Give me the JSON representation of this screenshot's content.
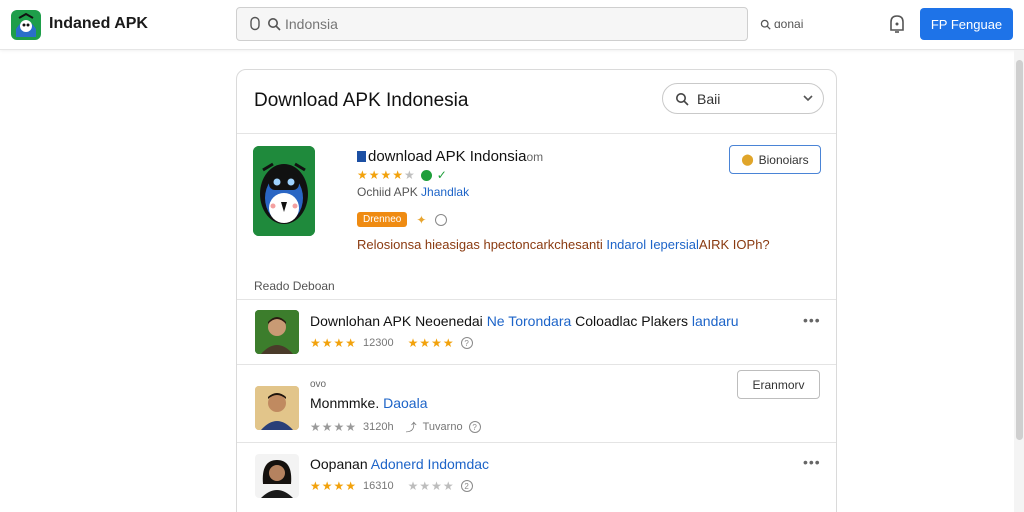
{
  "header": {
    "brand": "Indaned APK",
    "search_placeholder": "Indonsia",
    "search_link": "ɑonai",
    "cta_label": "FP Fenguae"
  },
  "card": {
    "title": "Download APK Indonesia",
    "filter_label": "Baii",
    "featured": {
      "title": "download APK Indonsia",
      "title_suffix": "om",
      "subtitle_prefix": "Ochiid APK",
      "subtitle_link": "Jhandlak",
      "badge": "Drenneo",
      "description_prefix": "Relosionsa hieasigas hpectoncarkchesanti",
      "description_blue": "Indarol Iepersial",
      "description_suffix": "AIRK IOPh?",
      "action_label": "Bionoiars",
      "rating": 4
    },
    "section_label": "Reado Deboan",
    "items": [
      {
        "title": "Downlohan APK Neoenedai",
        "title_blue": "Ne Torondara",
        "title_rest": "Coloadlac Plakers",
        "title_blue2": "landaru",
        "count": "12300",
        "rating_a": 4,
        "rating_b": 4,
        "has_menu": true
      },
      {
        "caption": "ovo",
        "title": "Monmmke.",
        "title_blue": "Daoala",
        "count": "3120h",
        "tag": "Tuvarno",
        "rating_a": 4,
        "action_label": "Eranmorv"
      },
      {
        "title": "Oopanan",
        "title_blue": "Adonerd Indomdac",
        "count": "16310",
        "rating_a": 4,
        "rating_b": 3,
        "has_menu": true
      }
    ]
  },
  "colors": {
    "primary": "#1e73e8",
    "star": "#f2a20c",
    "link": "#1d64c8",
    "badge": "#ef8b12",
    "app_bg": "#1f8a3c"
  }
}
